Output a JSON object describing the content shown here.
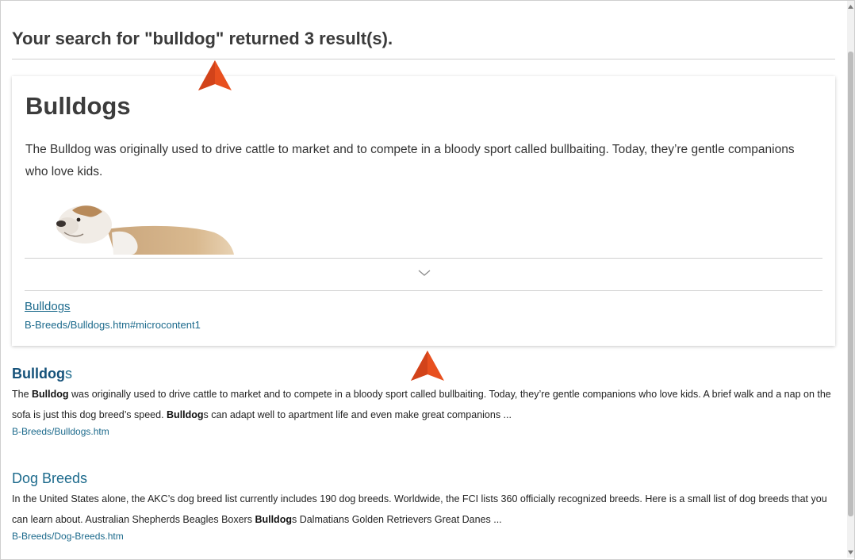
{
  "search": {
    "summary": "Your search for \"bulldog\" returned 3 result(s)."
  },
  "featured": {
    "heading": "Bulldogs",
    "body": "The Bulldog was originally used to drive cattle to market and to compete in a bloody sport called bullbaiting. Today, they’re gentle companions who love kids.",
    "image_icon": "bulldog-photo",
    "link_label": "Bulldogs",
    "path": "B-Breeds/Bulldogs.htm#microcontent1"
  },
  "results": [
    {
      "title_bold": "Bulldog",
      "title_rest": "s",
      "snippet": [
        {
          "t": "The ",
          "b": false
        },
        {
          "t": "Bulldog",
          "b": true
        },
        {
          "t": " was originally used to drive cattle to market and to compete in a bloody sport called bullbaiting. Today, they’re gentle companions who love kids. A brief walk and a nap on the sofa is just this dog breed’s speed. ",
          "b": false
        },
        {
          "t": "Bulldog",
          "b": true
        },
        {
          "t": "s can adapt well to apartment life and even make great companions ...",
          "b": false
        }
      ],
      "path": "B-Breeds/Bulldogs.htm"
    },
    {
      "title": "Dog Breeds",
      "snippet": [
        {
          "t": "In the United States alone, the AKC’s dog breed list currently includes 190 dog breeds. Worldwide, the FCI lists 360 officially recognized breeds. Here is a small list of dog breeds that you can learn about. Australian Shepherds Beagles Boxers ",
          "b": false
        },
        {
          "t": "Bulldog",
          "b": true
        },
        {
          "t": "s Dalmatians Golden Retrievers Great Danes ...",
          "b": false
        }
      ],
      "path": "B-Breeds/Dog-Breeds.htm"
    }
  ],
  "colors": {
    "link": "#1c6a8c",
    "marker": "#e8501f"
  },
  "icons": {
    "expand": "chevron-down-icon",
    "marker": "cursor-arrow-marker"
  }
}
